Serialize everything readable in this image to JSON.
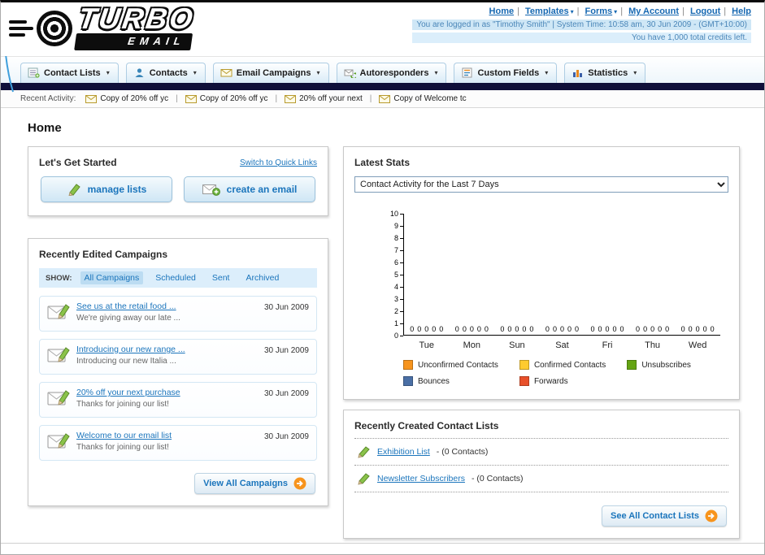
{
  "header": {
    "logo_primary": "TURBO",
    "logo_secondary": "EMAIL",
    "links": [
      {
        "label": "Home"
      },
      {
        "label": "Templates"
      },
      {
        "label": "Forms"
      },
      {
        "label": "My Account"
      },
      {
        "label": "Logout"
      },
      {
        "label": "Help"
      }
    ],
    "login_info": "You are logged in as \"Timothy Smith\" | System Time: 10:58 am, 30 Jun 2009 - (GMT+10:00)",
    "credits_info": "You have 1,000 total credits left."
  },
  "nav": {
    "tabs": [
      {
        "label": "Contact Lists"
      },
      {
        "label": "Contacts"
      },
      {
        "label": "Email Campaigns"
      },
      {
        "label": "Autoresponders"
      },
      {
        "label": "Custom Fields"
      },
      {
        "label": "Statistics"
      }
    ]
  },
  "recent_activity": {
    "label": "Recent Activity:",
    "items": [
      {
        "label": "Copy of 20% off yc"
      },
      {
        "label": "Copy of 20% off yc"
      },
      {
        "label": "20% off your next"
      },
      {
        "label": "Copy of Welcome tc"
      }
    ]
  },
  "page_title": "Home",
  "get_started": {
    "title": "Let's Get Started",
    "switch_link": "Switch to Quick Links",
    "manage_lists_label": "manage lists",
    "create_email_label": "create an email"
  },
  "campaigns": {
    "title": "Recently Edited Campaigns",
    "show_label": "SHOW:",
    "filters": [
      {
        "label": "All Campaigns",
        "active": true
      },
      {
        "label": "Scheduled",
        "active": false
      },
      {
        "label": "Sent",
        "active": false
      },
      {
        "label": "Archived",
        "active": false
      }
    ],
    "items": [
      {
        "title": "See us at the retail food ...",
        "subtitle": "We're giving away our late ...",
        "date": "30 Jun 2009"
      },
      {
        "title": "Introducing our new range ...",
        "subtitle": "Introducing our new Italia ...",
        "date": "30 Jun 2009"
      },
      {
        "title": "20% off your next purchase",
        "subtitle": "Thanks for joining our list!",
        "date": "30 Jun 2009"
      },
      {
        "title": "Welcome to our email list",
        "subtitle": "Thanks for joining our list!",
        "date": "30 Jun 2009"
      }
    ],
    "view_all_label": "View All Campaigns"
  },
  "stats": {
    "title": "Latest Stats",
    "selected_option": "Contact Activity for the Last 7 Days",
    "legend": [
      {
        "label": "Unconfirmed Contacts",
        "color": "#f7941d"
      },
      {
        "label": "Confirmed Contacts",
        "color": "#fecb2f"
      },
      {
        "label": "Unsubscribes",
        "color": "#64a413"
      },
      {
        "label": "Bounces",
        "color": "#4a6fa5"
      },
      {
        "label": "Forwards",
        "color": "#e8502a"
      }
    ]
  },
  "chart_data": {
    "type": "bar",
    "title": "Contact Activity for the Last 7 Days",
    "categories": [
      "Tue",
      "Mon",
      "Sun",
      "Sat",
      "Fri",
      "Thu",
      "Wed"
    ],
    "series": [
      {
        "name": "Unconfirmed Contacts",
        "color": "#f7941d",
        "values": [
          0,
          0,
          0,
          0,
          0,
          0,
          0
        ]
      },
      {
        "name": "Confirmed Contacts",
        "color": "#fecb2f",
        "values": [
          0,
          0,
          0,
          0,
          0,
          0,
          0
        ]
      },
      {
        "name": "Unsubscribes",
        "color": "#64a413",
        "values": [
          0,
          0,
          0,
          0,
          0,
          0,
          0
        ]
      },
      {
        "name": "Bounces",
        "color": "#4a6fa5",
        "values": [
          0,
          0,
          0,
          0,
          0,
          0,
          0
        ]
      },
      {
        "name": "Forwards",
        "color": "#e8502a",
        "values": [
          0,
          0,
          0,
          0,
          0,
          0,
          0
        ]
      }
    ],
    "ylim": [
      0,
      10
    ],
    "yticks": [
      0,
      1,
      2,
      3,
      4,
      5,
      6,
      7,
      8,
      9,
      10
    ],
    "grid": false,
    "legend_position": "bottom",
    "value_labels_shown": true
  },
  "contact_lists": {
    "title": "Recently Created Contact Lists",
    "items": [
      {
        "name": "Exhibition List",
        "suffix": "- (0 Contacts)"
      },
      {
        "name": "Newsletter Subscribers",
        "suffix": "- (0 Contacts)"
      }
    ],
    "see_all_label": "See All Contact Lists"
  },
  "icons": {
    "caret_down": "▾",
    "pipe": "|",
    "orange_arrow": "circle-arrow-right"
  }
}
